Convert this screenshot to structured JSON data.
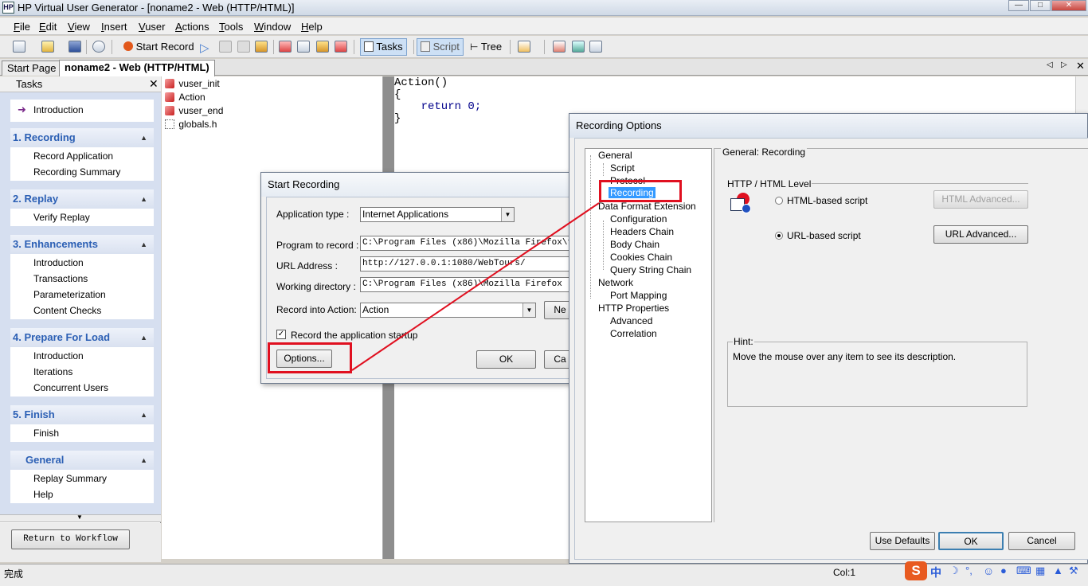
{
  "window": {
    "title": "HP Virtual User Generator - [noname2 - Web (HTTP/HTML)]",
    "app_icon": "HP"
  },
  "menu": [
    "File",
    "Edit",
    "View",
    "Insert",
    "Vuser",
    "Actions",
    "Tools",
    "Window",
    "Help"
  ],
  "toolbar": {
    "start_record": "Start Record",
    "tasks": "Tasks",
    "script": "Script",
    "tree": "Tree"
  },
  "tabs": [
    "Start Page",
    "noname2 - Web (HTTP/HTML)"
  ],
  "tasks_pane": {
    "title": "Tasks",
    "intro": "Introduction",
    "groups": [
      {
        "title": "1. Recording",
        "items": [
          "Record Application",
          "Recording Summary"
        ]
      },
      {
        "title": "2. Replay",
        "items": [
          "Verify Replay"
        ]
      },
      {
        "title": "3. Enhancements",
        "items": [
          "Introduction",
          "Transactions",
          "Parameterization",
          "Content Checks"
        ]
      },
      {
        "title": "4. Prepare For Load",
        "items": [
          "Introduction",
          "Iterations",
          "Concurrent Users"
        ]
      },
      {
        "title": "5. Finish",
        "items": [
          "Finish"
        ]
      },
      {
        "title": "General",
        "items": [
          "Replay Summary",
          "Help"
        ]
      }
    ],
    "return_button": "Return to Workflow"
  },
  "files": [
    "vuser_init",
    "Action",
    "vuser_end",
    "globals.h"
  ],
  "editor": {
    "lines": [
      "Action()",
      "{",
      "    return 0;",
      "}"
    ]
  },
  "start_recording": {
    "title": "Start Recording",
    "app_type_label": "Application type :",
    "app_type_value": "Internet Applications",
    "program_label": "Program to record :",
    "program_value": "C:\\Program Files (x86)\\Mozilla Firefox\\fir",
    "url_label": "URL Address :",
    "url_value": "http://127.0.0.1:1080/WebTours/",
    "workdir_label": "Working directory :",
    "workdir_value": "C:\\Program Files (x86)\\Mozilla Firefox",
    "action_label": "Record into Action:",
    "action_value": "Action",
    "new_button": "Ne",
    "startup_checkbox": "Record the application startup",
    "options_button": "Options...",
    "ok_button": "OK",
    "cancel_button": "Ca"
  },
  "recording_options": {
    "title": "Recording Options",
    "tree": [
      "General",
      "Script",
      "Protocol",
      "Recording",
      "Data Format Extension",
      "Configuration",
      "Headers Chain",
      "Body Chain",
      "Cookies Chain",
      "Query String Chain",
      "Network",
      "Port Mapping",
      "HTTP Properties",
      "Advanced",
      "Correlation"
    ],
    "section_title": "General: Recording",
    "level_title": "HTTP / HTML Level",
    "html_radio": "HTML-based script",
    "url_radio": "URL-based script",
    "html_adv_button": "HTML Advanced...",
    "url_adv_button": "URL Advanced...",
    "hint_title": "Hint:",
    "hint_text": "Move the mouse over any item to see its description.",
    "use_defaults": "Use Defaults",
    "ok": "OK",
    "cancel": "Cancel"
  },
  "status": {
    "left": "完成",
    "col": "Col:1"
  },
  "tray": {
    "ime": "中"
  },
  "colors": {
    "group_title": "#2b5fb4",
    "highlight_box": "#e01020",
    "selection": "#3399ff"
  }
}
